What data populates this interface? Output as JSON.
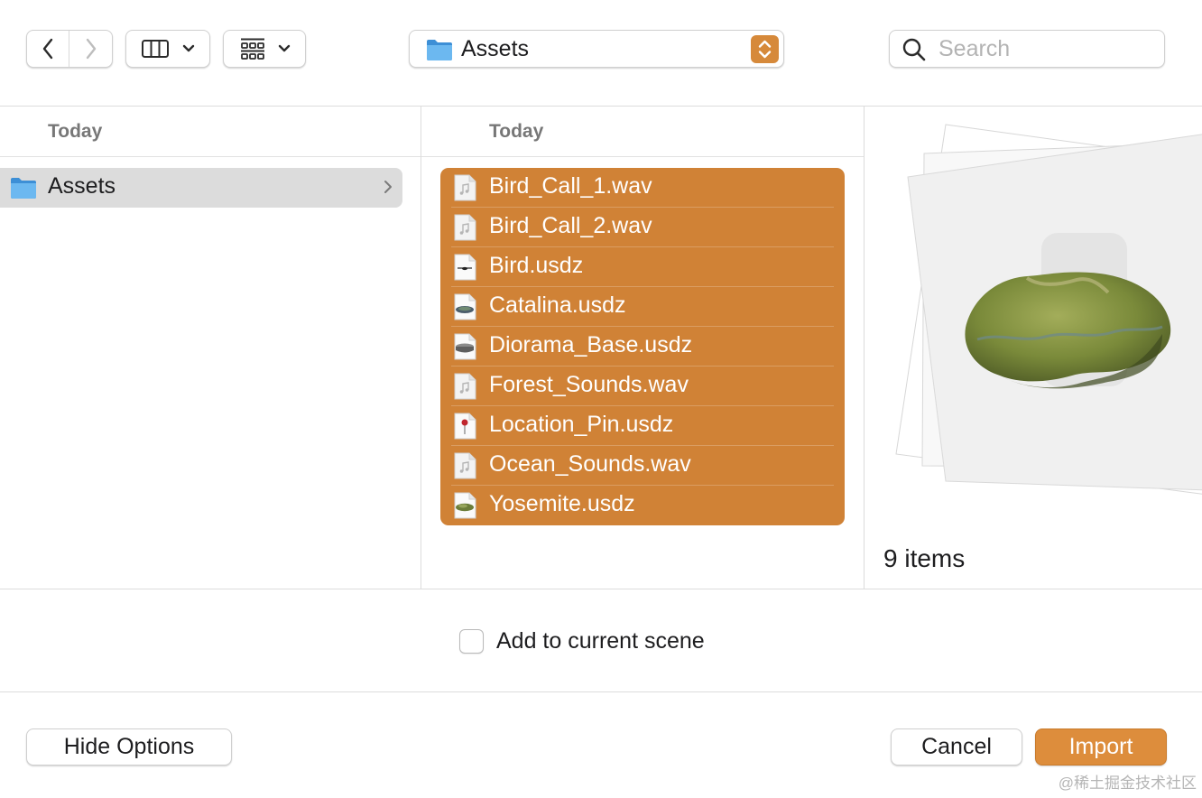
{
  "toolbar": {
    "path_label": "Assets",
    "search_placeholder": "Search"
  },
  "browser": {
    "column1": {
      "header": "Today",
      "items": [
        {
          "label": "Assets"
        }
      ]
    },
    "column2": {
      "header": "Today",
      "files": [
        {
          "name": "Bird_Call_1.wav",
          "kind": "audio"
        },
        {
          "name": "Bird_Call_2.wav",
          "kind": "audio"
        },
        {
          "name": "Bird.usdz",
          "kind": "model-bird"
        },
        {
          "name": "Catalina.usdz",
          "kind": "model-island"
        },
        {
          "name": "Diorama_Base.usdz",
          "kind": "model-base"
        },
        {
          "name": "Forest_Sounds.wav",
          "kind": "audio"
        },
        {
          "name": "Location_Pin.usdz",
          "kind": "model-pin"
        },
        {
          "name": "Ocean_Sounds.wav",
          "kind": "audio"
        },
        {
          "name": "Yosemite.usdz",
          "kind": "model-terrain"
        }
      ]
    }
  },
  "preview": {
    "items_count": "9 items"
  },
  "options": {
    "add_to_scene_label": "Add to current scene",
    "add_to_scene_checked": false
  },
  "footer": {
    "hide_options_label": "Hide Options",
    "cancel_label": "Cancel",
    "import_label": "Import"
  },
  "watermark": "@稀土掘金技术社区",
  "colors": {
    "accent": "#d08236",
    "primary_button": "#dd8d3c",
    "folder_blue": "#5aa9e6"
  }
}
